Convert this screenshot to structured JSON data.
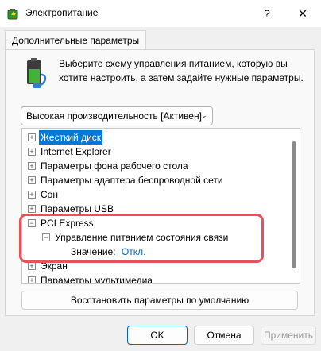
{
  "window": {
    "title": "Электропитание",
    "help_icon": "question-mark-icon",
    "close_icon": "close-icon"
  },
  "tab": {
    "label": "Дополнительные параметры"
  },
  "description": "Выберите схему управления питанием, которую вы хотите настроить, а затем задайте нужные параметры.",
  "scheme": {
    "selected": "Высокая производительность [Активен]"
  },
  "tree": {
    "items": [
      {
        "label": "Жесткий диск",
        "expander": "+",
        "selected": true
      },
      {
        "label": "Internet Explorer",
        "expander": "+"
      },
      {
        "label": "Параметры фона рабочего стола",
        "expander": "+"
      },
      {
        "label": "Параметры адаптера беспроводной сети",
        "expander": "+"
      },
      {
        "label": "Сон",
        "expander": "+"
      },
      {
        "label": "Параметры USB",
        "expander": "+"
      },
      {
        "label": "PCI Express",
        "expander": "−"
      },
      {
        "label": "Управление питанием состояния связи",
        "expander": "−"
      },
      {
        "value_label": "Значение:",
        "value": "Откл."
      },
      {
        "label": "Экран",
        "expander": "+"
      },
      {
        "label": "Параметры мультимедиа",
        "expander": "+"
      }
    ]
  },
  "buttons": {
    "restore": "Восстановить параметры по умолчанию",
    "ok": "OK",
    "cancel": "Отмена",
    "apply": "Применить"
  },
  "colors": {
    "highlight": "#e8505b",
    "selection": "#0078d7",
    "link": "#0066cc"
  }
}
